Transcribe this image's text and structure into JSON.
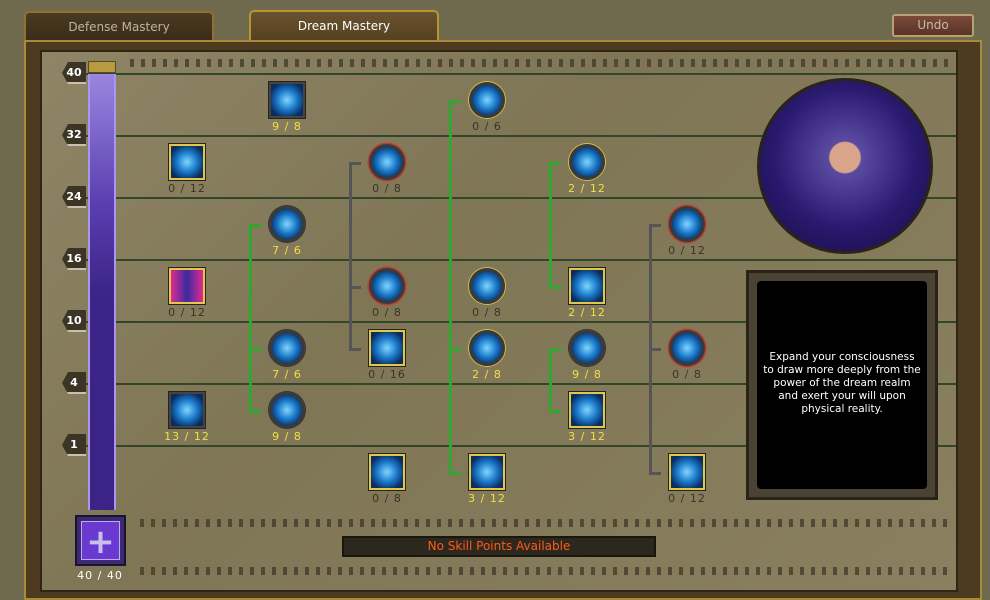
{
  "tabs": [
    {
      "label": "Defense Mastery",
      "active": false
    },
    {
      "label": "Dream Mastery",
      "active": true
    }
  ],
  "undo_label": "Undo",
  "level_markers": [
    "40",
    "32",
    "24",
    "16",
    "10",
    "4",
    "1"
  ],
  "mastery_points": "40 / 40",
  "status_text": "No Skill Points Available",
  "description": "Expand your consciousness to draw more deeply from the power of the dream realm and exert your will upon physical reality.",
  "colors": {
    "points_invested": "#f0e040",
    "points_zero": "#3a3428",
    "status": "#ff5a1a",
    "mastery_bar": "#3d2588"
  },
  "skills": [
    {
      "points": "9 / 8",
      "shape": "square",
      "border": "plain"
    },
    {
      "points": "0 / 12",
      "shape": "square",
      "border": "gold"
    },
    {
      "points": "0 / 8",
      "shape": "round",
      "border": "red"
    },
    {
      "points": "0 / 6",
      "shape": "round",
      "border": "gold"
    },
    {
      "points": "2 / 12",
      "shape": "round",
      "border": "gold"
    },
    {
      "points": "0 / 12",
      "shape": "round",
      "border": "red"
    },
    {
      "points": "7 / 6",
      "shape": "round",
      "border": "plain"
    },
    {
      "points": "0 / 12",
      "shape": "square",
      "border": "gold",
      "tint": "pink"
    },
    {
      "points": "0 / 8",
      "shape": "round",
      "border": "red"
    },
    {
      "points": "0 / 8",
      "shape": "round",
      "border": "gold"
    },
    {
      "points": "2 / 12",
      "shape": "square",
      "border": "gold"
    },
    {
      "points": "7 / 6",
      "shape": "round",
      "border": "plain"
    },
    {
      "points": "0 / 16",
      "shape": "square",
      "border": "gold"
    },
    {
      "points": "2 / 8",
      "shape": "round",
      "border": "gold"
    },
    {
      "points": "9 / 8",
      "shape": "round",
      "border": "plain"
    },
    {
      "points": "0 / 8",
      "shape": "round",
      "border": "red"
    },
    {
      "points": "13 / 12",
      "shape": "square",
      "border": "plain"
    },
    {
      "points": "9 / 8",
      "shape": "round",
      "border": "plain"
    },
    {
      "points": "3 / 12",
      "shape": "square",
      "border": "gold"
    },
    {
      "points": "0 / 8",
      "shape": "square",
      "border": "gold"
    },
    {
      "points": "3 / 12",
      "shape": "square",
      "border": "gold"
    },
    {
      "points": "0 / 12",
      "shape": "square",
      "border": "gold"
    }
  ]
}
